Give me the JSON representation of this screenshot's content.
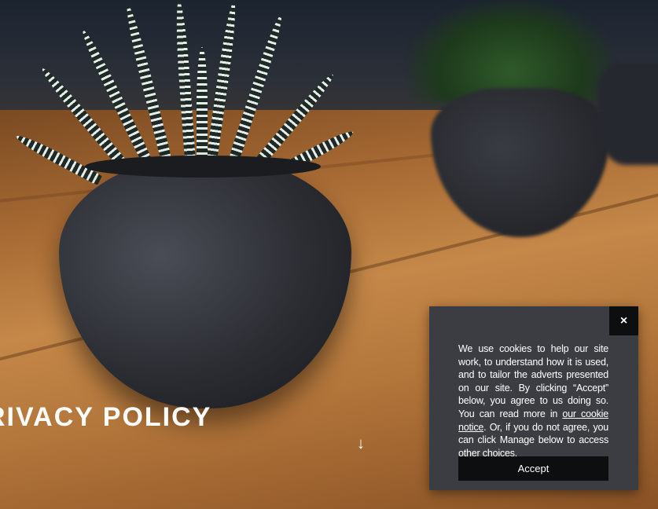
{
  "hero": {
    "title": "RIVACY POLICY",
    "scroll_icon": "arrow-down-icon",
    "scroll_glyph": "↓"
  },
  "cookie_banner": {
    "close_glyph": "×",
    "close_icon": "close-icon",
    "text_before_link": "We use cookies to help our site work, to understand how it is used, and to tailor the adverts presented on our site. By clicking “Accept” below, you agree to us doing so. You can read more in ",
    "link_text": "our cookie notice",
    "text_after_link": ". Or, if you do not agree, you can click Manage below to access other choices.",
    "accept_label": "Accept"
  },
  "colors": {
    "banner_bg": "#3b3d42",
    "button_bg": "#0d0e10",
    "text": "#ffffff"
  }
}
